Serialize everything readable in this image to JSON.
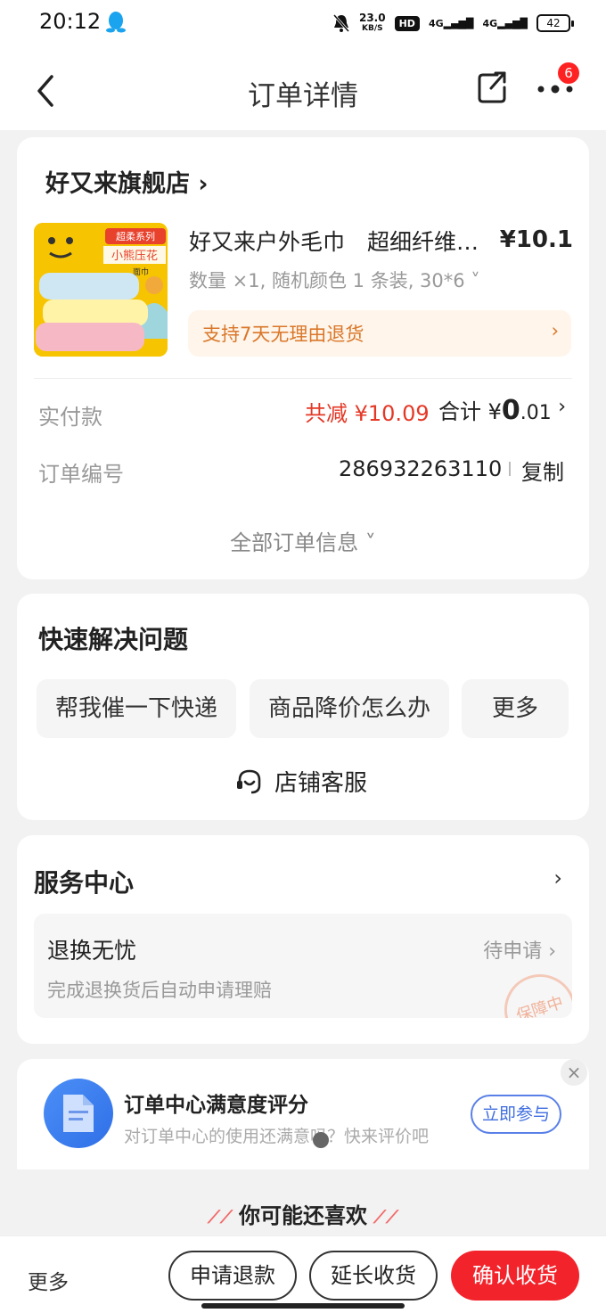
{
  "status_bar": {
    "time": "20:12",
    "speed_value": "23.0",
    "speed_unit": "KB/S",
    "hd": "HD",
    "signal1": "4G",
    "signal2": "4G",
    "battery": "42"
  },
  "header": {
    "title": "订单详情",
    "notification_count": "6"
  },
  "order": {
    "shop_name": "好又来旗舰店 ›",
    "product_name": "好又来户外毛巾　超细纤维…",
    "product_price": "¥10.1",
    "product_spec": "数量 ×1, 随机颜色 1 条装, 30*6 ˅",
    "return_policy": "支持7天无理由退货",
    "paid_label": "实付款",
    "discount": "共减 ¥10.09",
    "total_prefix": "合计 ¥",
    "total_int": "0",
    "total_dec": ".01",
    "order_no_label": "订单编号",
    "order_no": "286932263110",
    "copy_label": "复制",
    "all_info_label": "全部订单信息 ˅",
    "thumb_tag1": "超柔系列",
    "thumb_tag2": "小熊压花",
    "thumb_tag3": "面巾"
  },
  "quick": {
    "title": "快速解决问题",
    "chips": [
      "帮我催一下快递",
      "商品降价怎么办",
      "更多"
    ],
    "customer_service": "店铺客服"
  },
  "service": {
    "title": "服务中心",
    "item_name": "退换无忧",
    "item_sub": "完成退换货后自动申请理赔",
    "item_status": "待申请 ›",
    "stamp_text": "保障中"
  },
  "survey": {
    "title": "订单中心满意度评分",
    "subtitle": "对订单中心的使用还满意吗？快来评价吧",
    "join_label": "立即参与",
    "close": "×"
  },
  "guess": {
    "label": "你可能还喜欢"
  },
  "bottom_bar": {
    "more": "更多",
    "refund": "申请退款",
    "extend": "延长收货",
    "confirm": "确认收货"
  },
  "colors": {
    "accent_red": "#f3232b",
    "discount_red": "#e43826",
    "return_orange": "#d9772a",
    "link_blue": "#3f6de0"
  }
}
